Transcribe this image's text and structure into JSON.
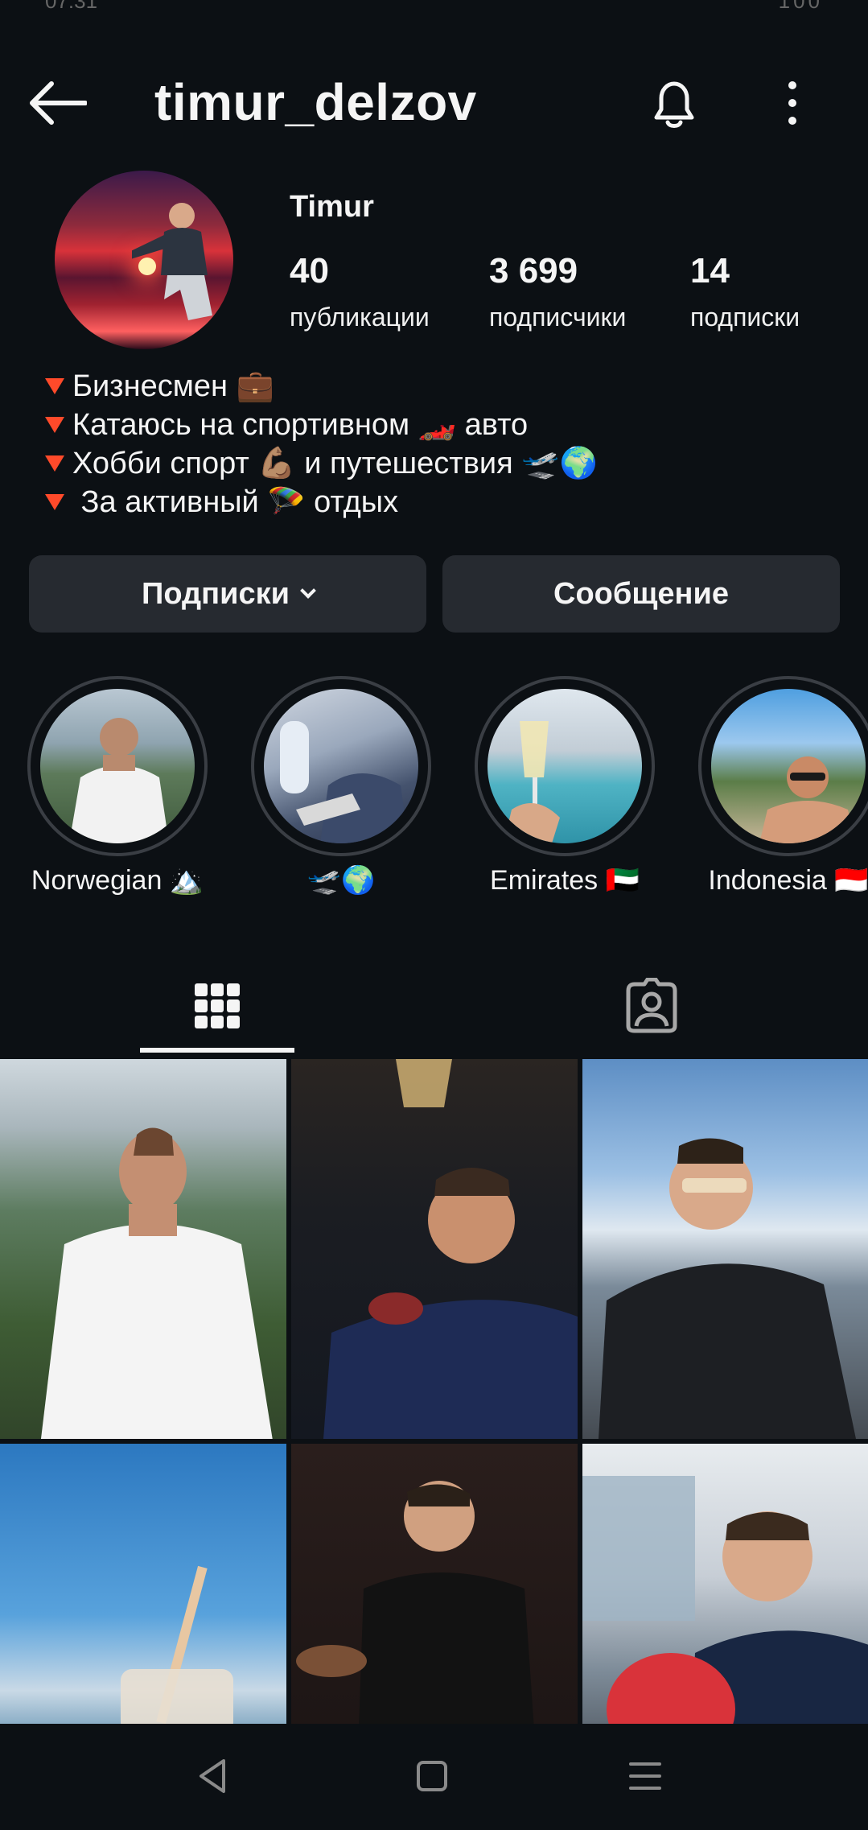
{
  "status_bar": {
    "time": "07:31",
    "battery": "100"
  },
  "header": {
    "username": "timur_delzov"
  },
  "profile": {
    "display_name": "Timur",
    "stats": [
      {
        "value": "40",
        "label": "публикации"
      },
      {
        "value": "3 699",
        "label": "подписчики"
      },
      {
        "value": "14",
        "label": "подписки"
      }
    ],
    "bio": [
      {
        "text": "Бизнесмен 💼"
      },
      {
        "text": "Катаюсь на спортивном 🏎️ авто"
      },
      {
        "text": "Хобби спорт 💪🏽 и путешествия 🛫🌍"
      },
      {
        "text": " За активный 🪂 отдых"
      }
    ]
  },
  "buttons": {
    "following": "Подписки",
    "message": "Сообщение"
  },
  "highlights": [
    {
      "label": "Norwegian 🏔️"
    },
    {
      "label": "🛫🌍"
    },
    {
      "label": "Emirates 🇦🇪"
    },
    {
      "label": "Indonesia 🇮🇩"
    }
  ],
  "tabs": [
    {
      "name": "posts-grid",
      "active": true
    },
    {
      "name": "tagged",
      "active": false
    }
  ],
  "colors": {
    "background": "#0c1014",
    "button": "#262a30",
    "bio_marker": "#ff4a2a"
  }
}
